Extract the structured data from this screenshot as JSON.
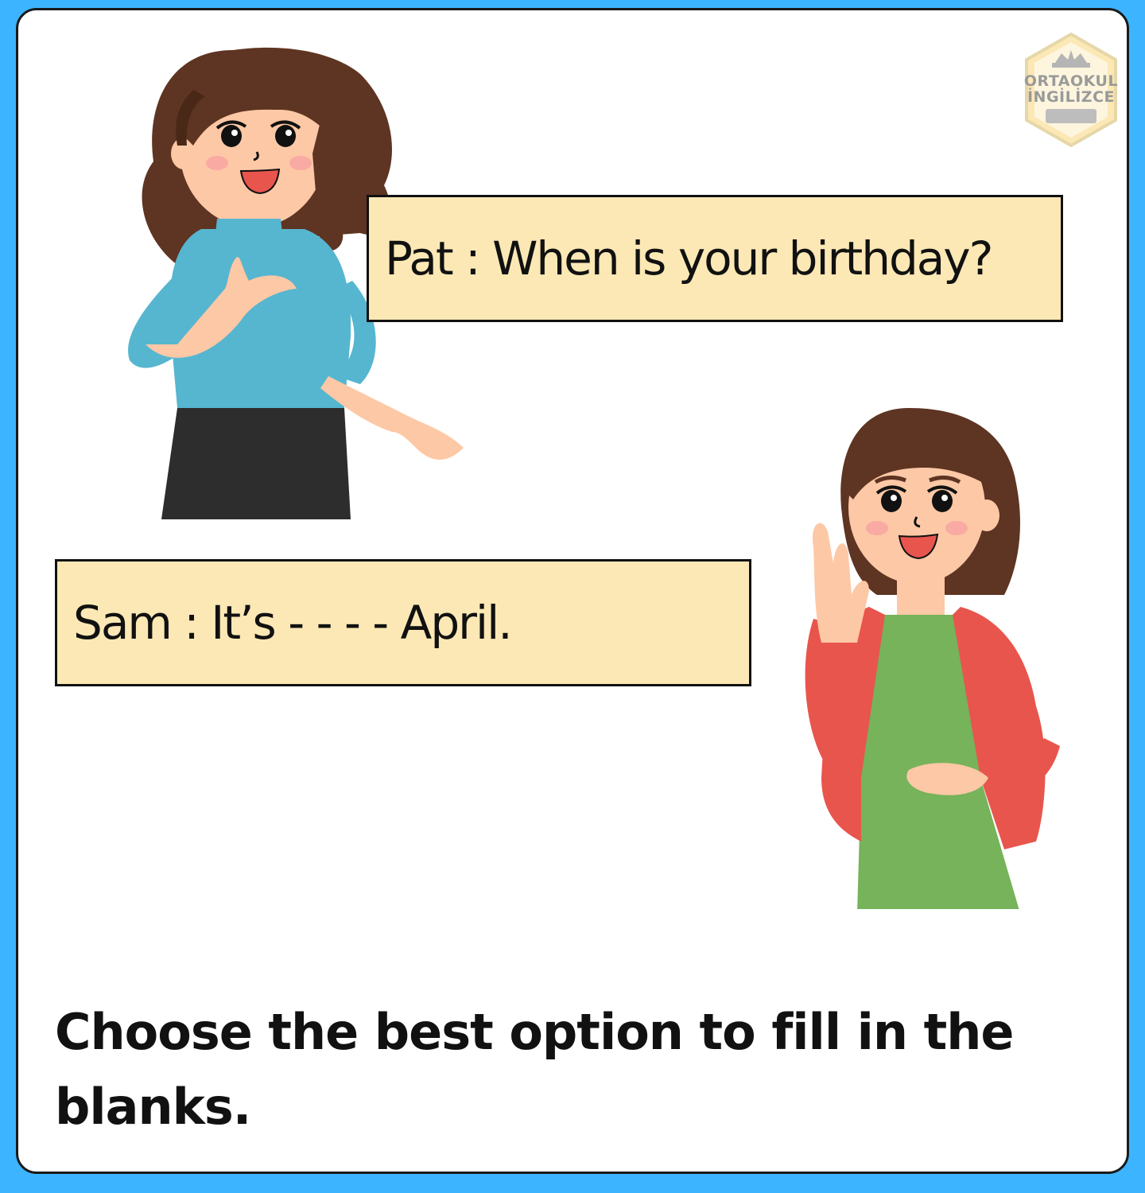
{
  "dialogue": {
    "pat_line": "Pat : When is your birthday?",
    "sam_line": "Sam : It’s - - - - April."
  },
  "instruction": "Choose the best option to fill in the blanks.",
  "logo": {
    "line1": "ORTAOKUL",
    "line2": "İNGİLİZCE"
  },
  "colors": {
    "background": "#3db4ff",
    "card": "#ffffff",
    "bubble": "#fbe8b5",
    "pat_top": "#56b6d0",
    "pat_skirt": "#2d2d2d",
    "sam_jacket": "#e8554d",
    "sam_shirt": "#76b35a",
    "hair": "#5e3422",
    "skin": "#fdc8a5"
  }
}
